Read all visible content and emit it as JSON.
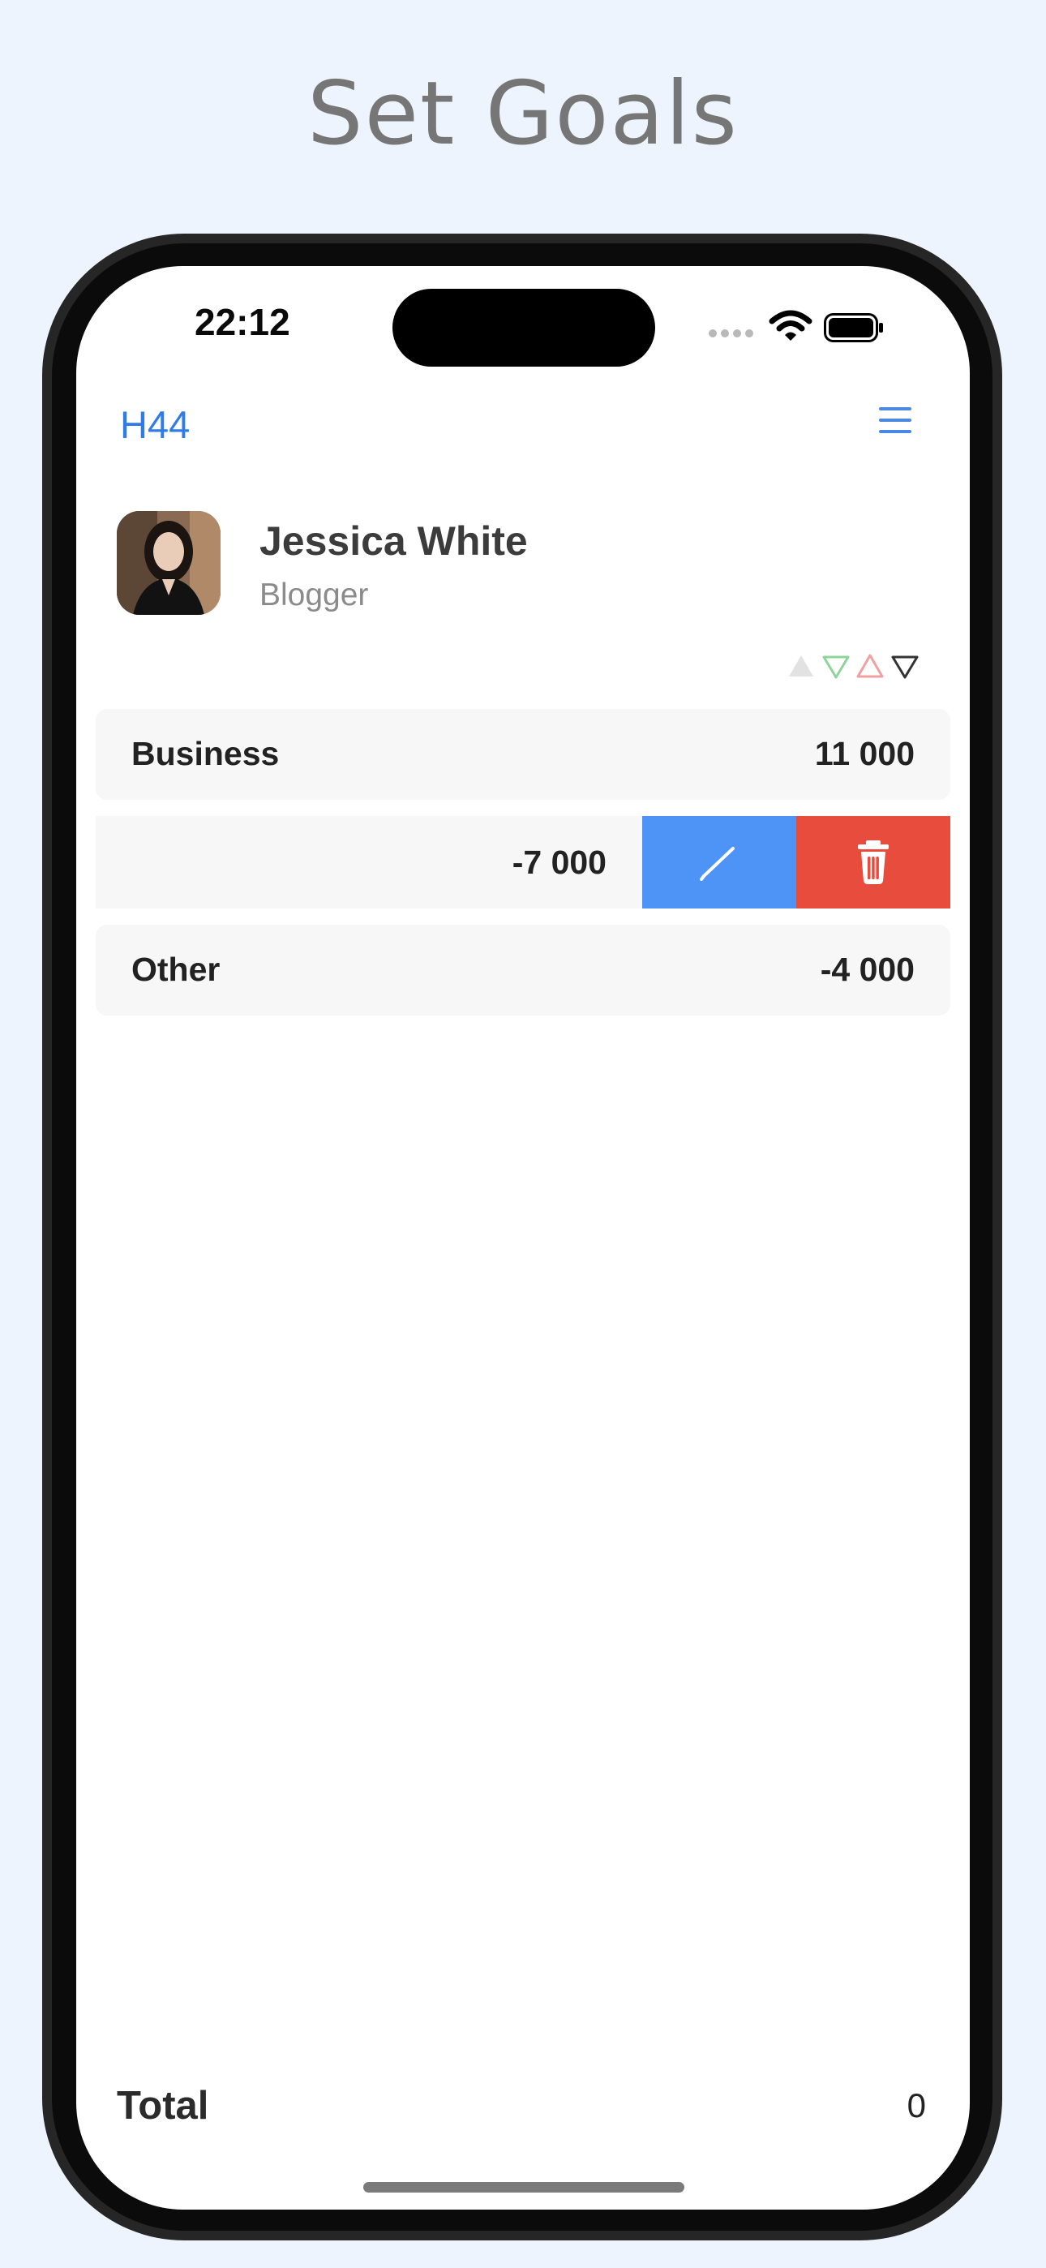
{
  "headline": "Set Goals",
  "status_bar": {
    "time": "22:12"
  },
  "nav": {
    "title": "H44",
    "menu_icon": "hamburger-menu-icon"
  },
  "profile": {
    "name": "Jessica White",
    "role": "Blogger"
  },
  "sort_icons": [
    "triangle-up-filled-gray",
    "triangle-down-outline-green",
    "triangle-up-outline-red",
    "triangle-down-outline-black"
  ],
  "goals": [
    {
      "label": "Business",
      "value": "11 000"
    },
    {
      "label": "",
      "value": "-7 000",
      "swiped": true,
      "actions": [
        "edit-pencil-icon",
        "trash-icon"
      ]
    },
    {
      "label": "Other",
      "value": "-4 000"
    }
  ],
  "total": {
    "label": "Total",
    "value": "0"
  },
  "colors": {
    "accent": "#2f7ce6",
    "edit": "#4d94f6",
    "delete": "#e84c3d",
    "background": "#eef4fd"
  }
}
